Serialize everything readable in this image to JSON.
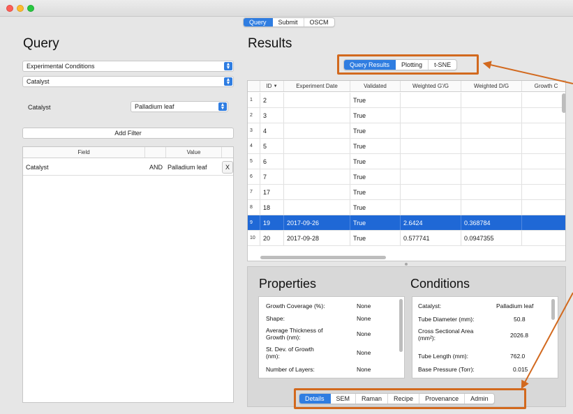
{
  "top_tabs": [
    {
      "label": "Query",
      "active": true
    },
    {
      "label": "Submit",
      "active": false
    },
    {
      "label": "OSCM",
      "active": false
    }
  ],
  "query": {
    "title": "Query",
    "category_select": "Experimental Conditions",
    "field_select": "Catalyst",
    "filter_label": "Catalyst",
    "filter_value": "Palladium leaf",
    "add_filter_label": "Add Filter",
    "filters_table": {
      "headers": [
        "Field",
        "Value"
      ],
      "rows": [
        {
          "field": "Catalyst",
          "op": "AND",
          "value": "Palladium leaf",
          "remove": "X"
        }
      ]
    }
  },
  "results": {
    "title": "Results",
    "tabs": [
      {
        "label": "Query Results",
        "active": true
      },
      {
        "label": "Plotting",
        "active": false
      },
      {
        "label": "t-SNE",
        "active": false
      }
    ],
    "columns": [
      "ID",
      "Experiment Date",
      "Validated",
      "Weighted G'/G",
      "Weighted D/G",
      "Growth C"
    ],
    "sort_indicator": "▼",
    "rows": [
      {
        "n": "1",
        "id": "2",
        "date": "",
        "validated": "True",
        "g": "",
        "d": ""
      },
      {
        "n": "2",
        "id": "3",
        "date": "",
        "validated": "True",
        "g": "",
        "d": ""
      },
      {
        "n": "3",
        "id": "4",
        "date": "",
        "validated": "True",
        "g": "",
        "d": ""
      },
      {
        "n": "4",
        "id": "5",
        "date": "",
        "validated": "True",
        "g": "",
        "d": ""
      },
      {
        "n": "5",
        "id": "6",
        "date": "",
        "validated": "True",
        "g": "",
        "d": ""
      },
      {
        "n": "6",
        "id": "7",
        "date": "",
        "validated": "True",
        "g": "",
        "d": ""
      },
      {
        "n": "7",
        "id": "17",
        "date": "",
        "validated": "True",
        "g": "",
        "d": ""
      },
      {
        "n": "8",
        "id": "18",
        "date": "",
        "validated": "True",
        "g": "",
        "d": ""
      },
      {
        "n": "9",
        "id": "19",
        "date": "2017-09-26",
        "validated": "True",
        "g": "2.6424",
        "d": "0.368784",
        "selected": true
      },
      {
        "n": "10",
        "id": "20",
        "date": "2017-09-28",
        "validated": "True",
        "g": "0.577741",
        "d": "0.0947355"
      }
    ]
  },
  "properties": {
    "title": "Properties",
    "items": [
      {
        "label": "Growth Coverage (%):",
        "value": "None"
      },
      {
        "label": "Shape:",
        "value": "None"
      },
      {
        "label": "Average Thickness of Growth (nm):",
        "value": "None"
      },
      {
        "label": "St. Dev. of Growth (nm):",
        "value": "None"
      },
      {
        "label": "Number of Layers:",
        "value": "None"
      }
    ]
  },
  "conditions": {
    "title": "Conditions",
    "items": [
      {
        "label": "Catalyst:",
        "value": "Palladium leaf"
      },
      {
        "label": "Tube Diameter (mm):",
        "value": "50.8"
      },
      {
        "label": "Cross Sectional Area (mm²):",
        "value": "2026.8"
      },
      {
        "label": "Tube Length (mm):",
        "value": "762.0"
      },
      {
        "label": "Base Pressure (Torr):",
        "value": "0.015"
      }
    ]
  },
  "detail_tabs": [
    {
      "label": "Details",
      "active": true
    },
    {
      "label": "SEM",
      "active": false
    },
    {
      "label": "Raman",
      "active": false
    },
    {
      "label": "Recipe",
      "active": false
    },
    {
      "label": "Provenance",
      "active": false
    },
    {
      "label": "Admin",
      "active": false
    }
  ],
  "colors": {
    "accent": "#2f7de1",
    "selection": "#1f68d6",
    "annotation": "#d2691e"
  }
}
